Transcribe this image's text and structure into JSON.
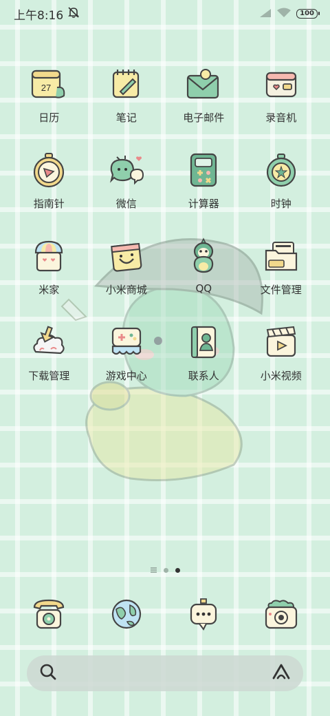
{
  "status_bar": {
    "time": "上午8:16",
    "battery": "100",
    "icons": [
      "mute-bell-icon",
      "signal-icon",
      "wifi-icon",
      "battery-icon"
    ]
  },
  "apps": [
    {
      "label": "日历",
      "icon": "calendar-icon",
      "date": "27"
    },
    {
      "label": "笔记",
      "icon": "notes-icon"
    },
    {
      "label": "电子邮件",
      "icon": "email-icon"
    },
    {
      "label": "录音机",
      "icon": "recorder-icon"
    },
    {
      "label": "指南针",
      "icon": "compass-icon"
    },
    {
      "label": "微信",
      "icon": "wechat-icon"
    },
    {
      "label": "计算器",
      "icon": "calculator-icon"
    },
    {
      "label": "时钟",
      "icon": "clock-icon"
    },
    {
      "label": "米家",
      "icon": "mijia-icon"
    },
    {
      "label": "小米商城",
      "icon": "mi-store-icon"
    },
    {
      "label": "QQ",
      "icon": "qq-icon"
    },
    {
      "label": "文件管理",
      "icon": "file-manager-icon"
    },
    {
      "label": "下载管理",
      "icon": "download-manager-icon"
    },
    {
      "label": "游戏中心",
      "icon": "game-center-icon"
    },
    {
      "label": "联系人",
      "icon": "contacts-icon"
    },
    {
      "label": "小米视频",
      "icon": "mi-video-icon"
    }
  ],
  "dock": [
    {
      "name": "phone",
      "icon": "phone-icon"
    },
    {
      "name": "browser",
      "icon": "globe-icon"
    },
    {
      "name": "messages",
      "icon": "message-icon"
    },
    {
      "name": "camera",
      "icon": "camera-icon"
    }
  ],
  "pages": {
    "count": 2,
    "current": 2
  },
  "colors": {
    "background": "#d3efdf",
    "accent_green": "#7cc9a2",
    "accent_yellow": "#f4e49a",
    "text": "#333333"
  }
}
